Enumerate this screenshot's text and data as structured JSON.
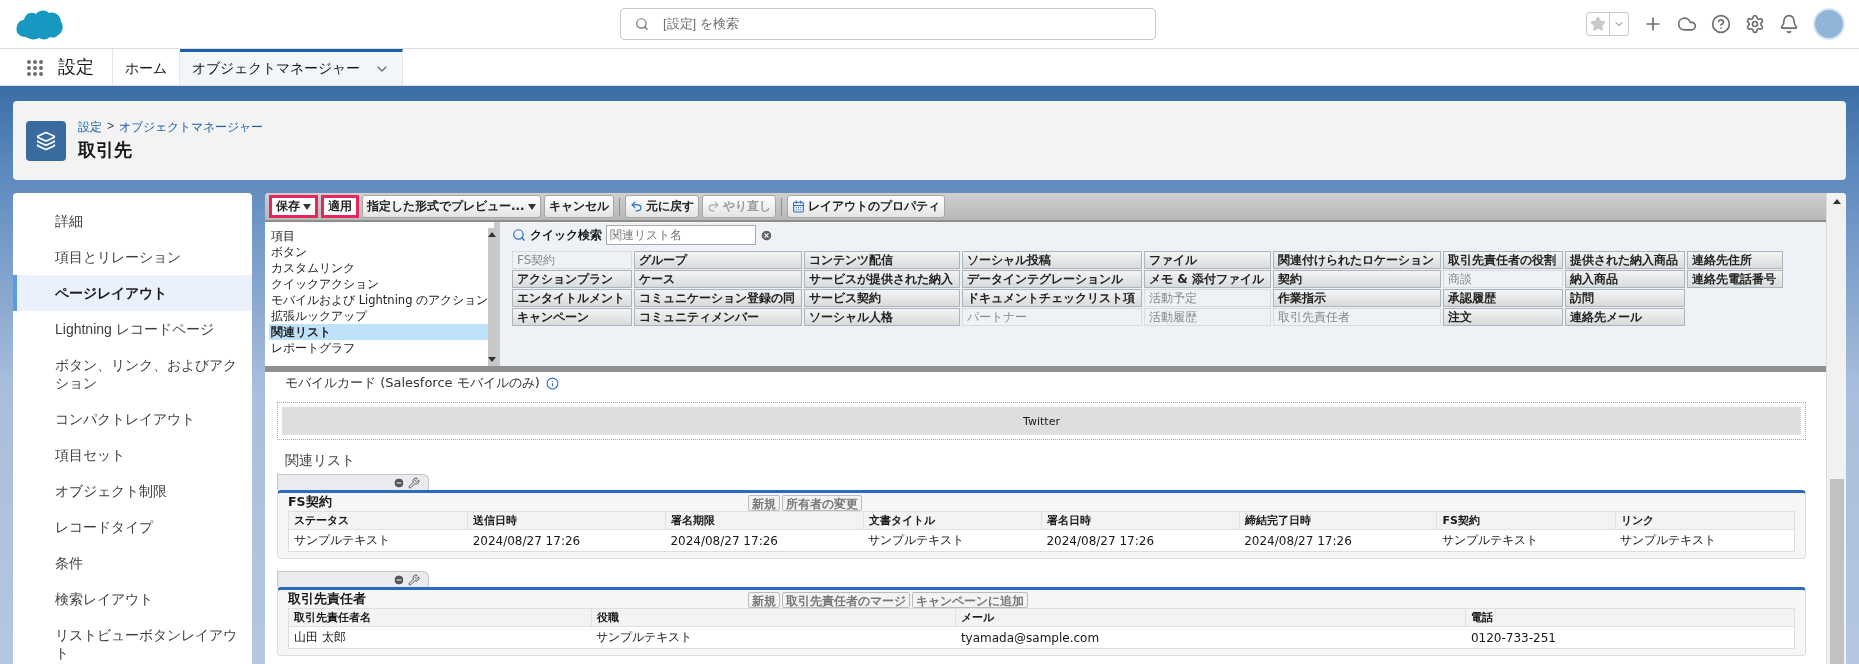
{
  "top_bar": {
    "search": {
      "placeholder": "[設定] を検索"
    }
  },
  "nav": {
    "app_name": "設定",
    "tabs": [
      {
        "label": "ホーム",
        "selected": false
      },
      {
        "label": "オブジェクトマネージャー",
        "selected": true
      }
    ]
  },
  "header": {
    "breadcrumb": [
      "設定",
      "オブジェクトマネージャー"
    ],
    "separator": ">",
    "title": "取引先"
  },
  "sidebar": {
    "items": [
      {
        "label": "詳細",
        "selected": false
      },
      {
        "label": "項目とリレーション",
        "selected": false
      },
      {
        "label": "ページレイアウト",
        "selected": true
      },
      {
        "label": "Lightning レコードページ",
        "selected": false
      },
      {
        "label": "ボタン、リンク、およびアクション",
        "selected": false
      },
      {
        "label": "コンパクトレイアウト",
        "selected": false
      },
      {
        "label": "項目セット",
        "selected": false
      },
      {
        "label": "オブジェクト制限",
        "selected": false
      },
      {
        "label": "レコードタイプ",
        "selected": false
      },
      {
        "label": "条件",
        "selected": false
      },
      {
        "label": "検索レイアウト",
        "selected": false
      },
      {
        "label": "リストビューボタンレイアウト",
        "selected": false
      }
    ]
  },
  "toolbar": {
    "buttons": [
      {
        "label": "保存",
        "kind": "split",
        "highlighted": true,
        "disabled": false
      },
      {
        "label": "適用",
        "kind": "plain",
        "highlighted": true,
        "disabled": false
      },
      {
        "label": "指定した形式でプレビュー...",
        "kind": "dropdown",
        "highlighted": false,
        "disabled": false
      },
      {
        "label": "キャンセル",
        "kind": "plain",
        "highlighted": false,
        "disabled": false
      },
      {
        "label": "元に戻す",
        "kind": "undo",
        "highlighted": false,
        "disabled": false
      },
      {
        "label": "やり直し",
        "kind": "redo",
        "highlighted": false,
        "disabled": true
      },
      {
        "label": "レイアウトのプロパティ",
        "kind": "properties",
        "highlighted": false,
        "disabled": false
      }
    ]
  },
  "palette": {
    "categories": [
      {
        "label": "項目",
        "selected": false
      },
      {
        "label": "ボタン",
        "selected": false
      },
      {
        "label": "カスタムリンク",
        "selected": false
      },
      {
        "label": "クイックアクション",
        "selected": false
      },
      {
        "label": "モバイルおよび Lightning のアクション",
        "selected": false
      },
      {
        "label": "拡張ルックアップ",
        "selected": false
      },
      {
        "label": "関連リスト",
        "selected": true
      },
      {
        "label": "レポートグラフ",
        "selected": false
      }
    ],
    "quick_search": {
      "label": "クイック検索",
      "placeholder": "関連リスト名"
    },
    "rows": [
      [
        {
          "label": "FS契約",
          "placed": true
        },
        {
          "label": "グループ",
          "placed": false
        },
        {
          "label": "コンテンツ配信",
          "placed": false
        },
        {
          "label": "ソーシャル投稿",
          "placed": false
        },
        {
          "label": "ファイル",
          "placed": false
        },
        {
          "label": "関連付けられたロケーション",
          "placed": false
        },
        {
          "label": "取引先責任者の役割",
          "placed": false
        },
        {
          "label": "提供された納入商品",
          "placed": false
        },
        {
          "label": "連絡先住所",
          "placed": false
        }
      ],
      [
        {
          "label": "アクションプラン",
          "placed": false
        },
        {
          "label": "ケース",
          "placed": false
        },
        {
          "label": "サービスが提供された納入",
          "placed": false
        },
        {
          "label": "データインテグレーションル",
          "placed": false
        },
        {
          "label": "メモ & 添付ファイル",
          "placed": false
        },
        {
          "label": "契約",
          "placed": false
        },
        {
          "label": "商談",
          "placed": true
        },
        {
          "label": "納入商品",
          "placed": false
        },
        {
          "label": "連絡先電話番号",
          "placed": false
        }
      ],
      [
        {
          "label": "エンタイトルメント",
          "placed": false
        },
        {
          "label": "コミュニケーション登録の同",
          "placed": false
        },
        {
          "label": "サービス契約",
          "placed": false
        },
        {
          "label": "ドキュメントチェックリスト項",
          "placed": false
        },
        {
          "label": "活動予定",
          "placed": true
        },
        {
          "label": "作業指示",
          "placed": false
        },
        {
          "label": "承認履歴",
          "placed": false
        },
        {
          "label": "訪問",
          "placed": false
        }
      ],
      [
        {
          "label": "キャンペーン",
          "placed": false
        },
        {
          "label": "コミュニティメンバー",
          "placed": false
        },
        {
          "label": "ソーシャル人格",
          "placed": false
        },
        {
          "label": "パートナー",
          "placed": true
        },
        {
          "label": "活動履歴",
          "placed": true
        },
        {
          "label": "取引先責任者",
          "placed": true
        },
        {
          "label": "注文",
          "placed": false
        },
        {
          "label": "連絡先メール",
          "placed": false
        }
      ]
    ]
  },
  "layout": {
    "mobile_cards": {
      "title": "モバイルカード (Salesforce モバイルのみ)",
      "cards": [
        "Twitter"
      ]
    },
    "related_lists_title": "関連リスト",
    "related_lists": [
      {
        "title": "FS契約",
        "buttons": [
          "新規",
          "所有者の変更"
        ],
        "columns": [
          "ステータス",
          "送信日時",
          "署名期限",
          "文書タイトル",
          "署名日時",
          "締結完了日時",
          "FS契約",
          "リンク"
        ],
        "rows": [
          [
            "サンプルテキスト",
            "2024/08/27 17:26",
            "2024/08/27 17:26",
            "サンプルテキスト",
            "2024/08/27 17:26",
            "2024/08/27 17:26",
            "サンプルテキスト",
            "サンプルテキスト"
          ]
        ]
      },
      {
        "title": "取引先責任者",
        "buttons": [
          "新規",
          "取引先責任者のマージ",
          "キャンペーンに追加"
        ],
        "columns": [
          "取引先責任者名",
          "役職",
          "メール",
          "電話"
        ],
        "rows": [
          [
            "山田 太郎",
            "サンプルテキスト",
            "tyamada@sample.com",
            "0120-733-251"
          ]
        ]
      }
    ]
  }
}
